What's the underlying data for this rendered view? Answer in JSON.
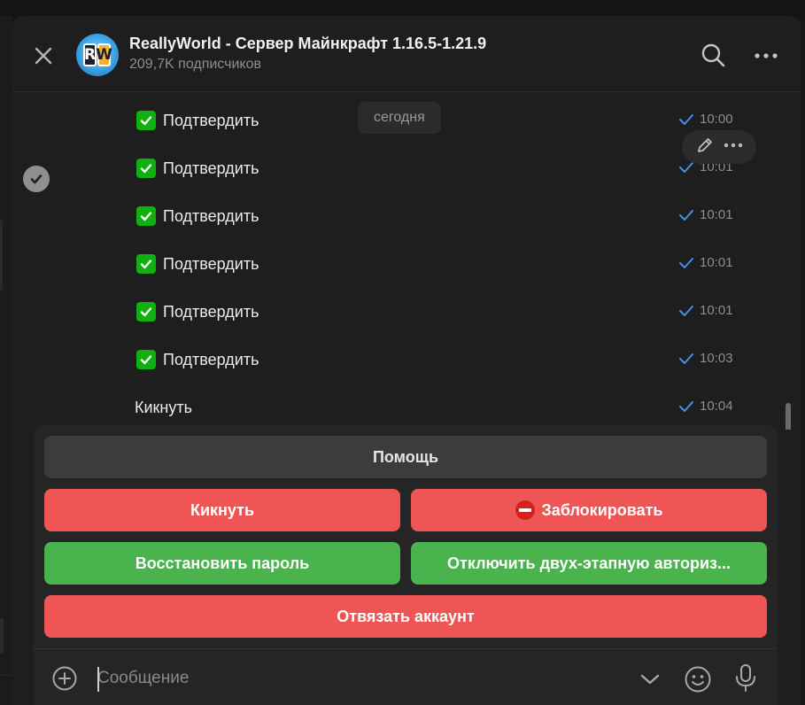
{
  "header": {
    "title": "ReallyWorld - Сервер Майнкрафт 1.16.5-1.21.9",
    "subtitle": "209,7K подписчиков",
    "avatar_letters": [
      "R",
      "W"
    ]
  },
  "date_pill": "сегодня",
  "messages": [
    {
      "text": "Подтвердить",
      "time": "10:00",
      "checkbox": true
    },
    {
      "text": "Подтвердить",
      "time": "10:01",
      "checkbox": true
    },
    {
      "text": "Подтвердить",
      "time": "10:01",
      "checkbox": true
    },
    {
      "text": "Подтвердить",
      "time": "10:01",
      "checkbox": true
    },
    {
      "text": "Подтвердить",
      "time": "10:01",
      "checkbox": true
    },
    {
      "text": "Подтвердить",
      "time": "10:03",
      "checkbox": true
    },
    {
      "text": "Кикнуть",
      "time": "10:04",
      "checkbox": false
    }
  ],
  "keyboard": {
    "help": "Помощь",
    "kick": "Кикнуть",
    "block": "Заблокировать",
    "restore_password": "Восстановить пароль",
    "disable_2fa": "Отключить двух-этапную авториз...",
    "unlink_account": "Отвязать аккаунт"
  },
  "composer": {
    "placeholder": "Сообщение"
  },
  "colors": {
    "background": "#1e1e1e",
    "red_button": "#f05555",
    "green_button": "#4ab34e",
    "gray_button": "#3c3c3c",
    "read_check": "#4a90e2"
  },
  "icons": {
    "close": "close-icon",
    "search": "search-icon",
    "more": "more-horizontal-icon",
    "edit": "pencil-icon",
    "scroll_down": "chevron-down-icon",
    "attach": "plus-circle-icon",
    "emoji": "smile-icon",
    "mic": "microphone-icon",
    "block": "no-entry-icon"
  }
}
